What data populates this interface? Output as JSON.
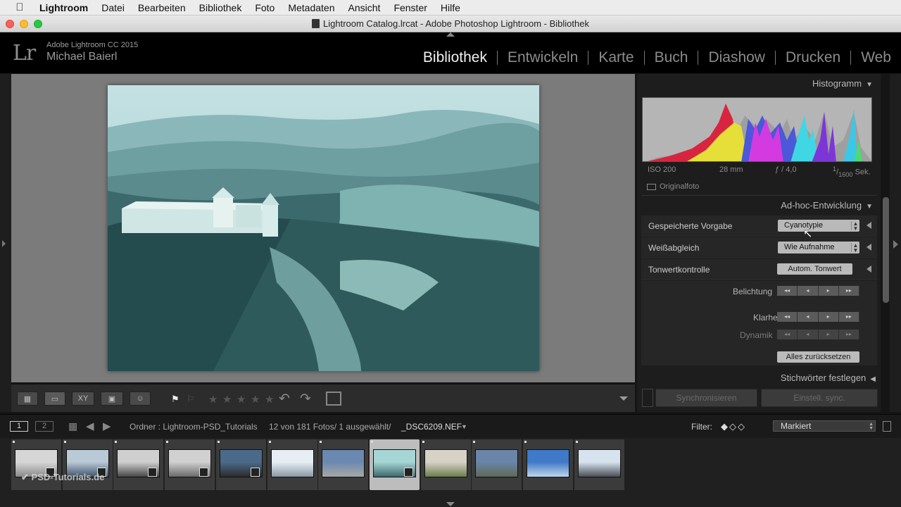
{
  "menubar": {
    "app_name": "Lightroom",
    "items": [
      "Datei",
      "Bearbeiten",
      "Bibliothek",
      "Foto",
      "Metadaten",
      "Ansicht",
      "Fenster",
      "Hilfe"
    ]
  },
  "window": {
    "title": "Lightroom Catalog.lrcat - Adobe Photoshop Lightroom - Bibliothek"
  },
  "identity": {
    "logo": "Lr",
    "product": "Adobe Lightroom CC 2015",
    "user": "Michael Baierl"
  },
  "modules": [
    "Bibliothek",
    "Entwickeln",
    "Karte",
    "Buch",
    "Diashow",
    "Drucken",
    "Web"
  ],
  "active_module": "Bibliothek",
  "histogram": {
    "title": "Histogramm",
    "iso": "ISO 200",
    "focal": "28 mm",
    "aperture": "ƒ / 4,0",
    "shutter_num": "1",
    "shutter_den": "1600",
    "shutter_unit": "Sek.",
    "original_label": "Originalfoto"
  },
  "quick_develop": {
    "title": "Ad-hoc-Entwicklung",
    "preset_label": "Gespeicherte Vorgabe",
    "preset_value": "Cyanotypie",
    "wb_label": "Weißabgleich",
    "wb_value": "Wie Aufnahme",
    "tone_label": "Tonwertkontrolle",
    "auto_tone": "Autom. Tonwert",
    "exposure_label": "Belichtung",
    "clarity_label": "Klarheit",
    "vibrance_label": "Dynamik",
    "reset_all": "Alles zurücksetzen",
    "keywording_title": "Stichwörter festlegen"
  },
  "sync": {
    "sync_button": "Synchronisieren",
    "settings_button": "Einstell. sync."
  },
  "filmstrip_header": {
    "page1": "1",
    "page2": "2",
    "source": "Ordner : Lightroom-PSD_Tutorials",
    "count": "12 von 181 Fotos/ 1 ausgewählt/",
    "filename": "_DSC6209.NEF",
    "filter_label": "Filter:",
    "filter_value": "Markiert"
  },
  "watermark": "PSD-Tutorials.de",
  "rating_stars": 0,
  "thumbnail_count": 12,
  "selected_thumbnail": 8
}
